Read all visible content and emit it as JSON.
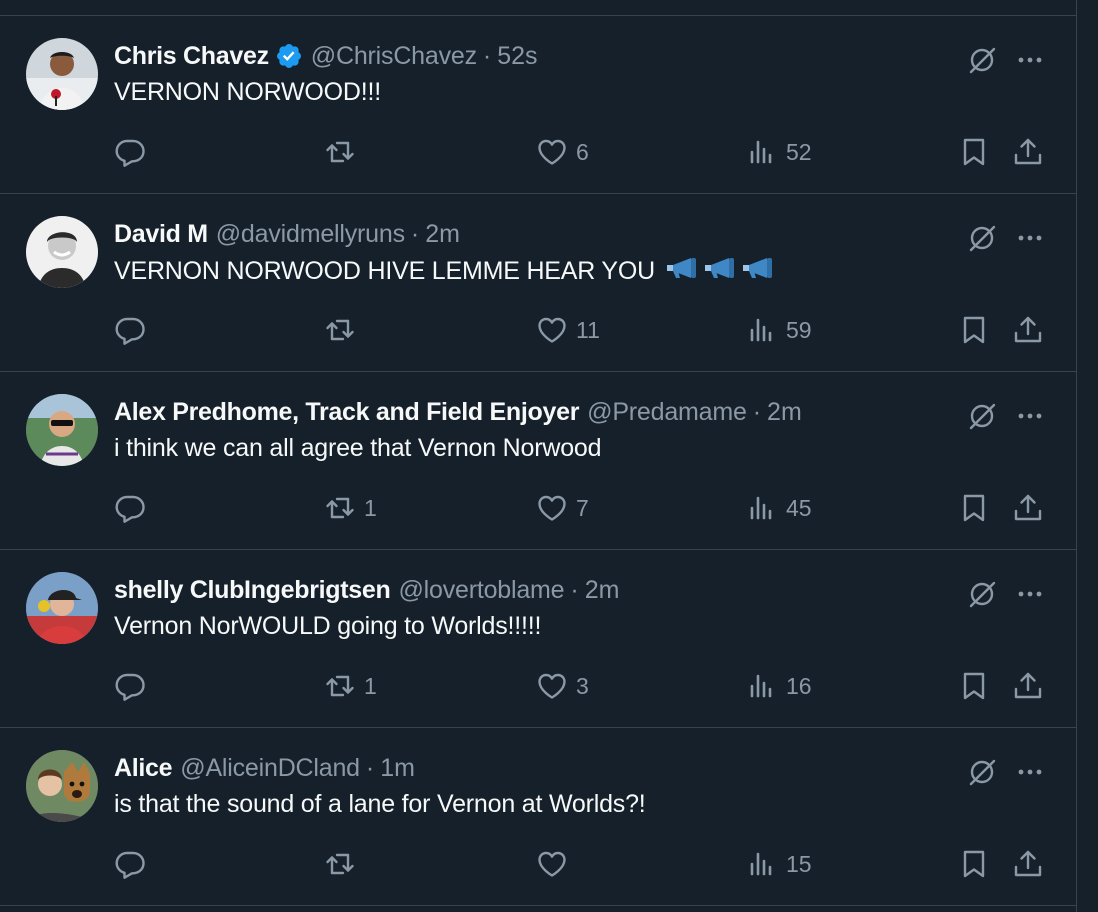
{
  "colors": {
    "background": "#15202b",
    "border": "#38444d",
    "text": "#f7f9f9",
    "muted": "#8b98a5",
    "verified": "#1d9bf0"
  },
  "tweets": [
    {
      "name": "Chris Chavez",
      "verified": true,
      "handle": "@ChrisChavez",
      "separator": "·",
      "time": "52s",
      "text": "VERNON NORWOOD!!!",
      "emoji": [],
      "replies": "",
      "retweets": "",
      "likes": "6",
      "views": "52",
      "avatar_icon": "person-with-microphone-avatar"
    },
    {
      "name": "David M",
      "verified": false,
      "handle": "@davidmellyruns",
      "separator": "·",
      "time": "2m",
      "text": "VERNON NORWOOD HIVE LEMME HEAR YOU",
      "emoji": [
        "megaphone-emoji",
        "megaphone-emoji",
        "megaphone-emoji"
      ],
      "replies": "",
      "retweets": "",
      "likes": "11",
      "views": "59",
      "avatar_icon": "smiling-man-bw-avatar"
    },
    {
      "name": "Alex Predhome, Track and Field Enjoyer",
      "verified": false,
      "handle": "@Predamame",
      "separator": "·",
      "time": "2m",
      "text": "i think we can all agree that Vernon Norwood",
      "emoji": [],
      "replies": "",
      "retweets": "1",
      "likes": "7",
      "views": "45",
      "avatar_icon": "man-with-sunglasses-avatar"
    },
    {
      "name": "shelly ClubIngebrigtsen",
      "verified": false,
      "handle": "@lovertoblame",
      "separator": "·",
      "time": "2m",
      "text": "Vernon NorWOULD going to Worlds!!!!!",
      "emoji": [],
      "replies": "",
      "retweets": "1",
      "likes": "3",
      "views": "16",
      "avatar_icon": "person-with-cap-avatar"
    },
    {
      "name": "Alice",
      "verified": false,
      "handle": "@AliceinDCland",
      "separator": "·",
      "time": "1m",
      "text": "is that the sound of a lane for Vernon at Worlds?!",
      "emoji": [],
      "replies": "",
      "retweets": "",
      "likes": "",
      "views": "15",
      "avatar_icon": "person-with-dog-avatar"
    }
  ]
}
